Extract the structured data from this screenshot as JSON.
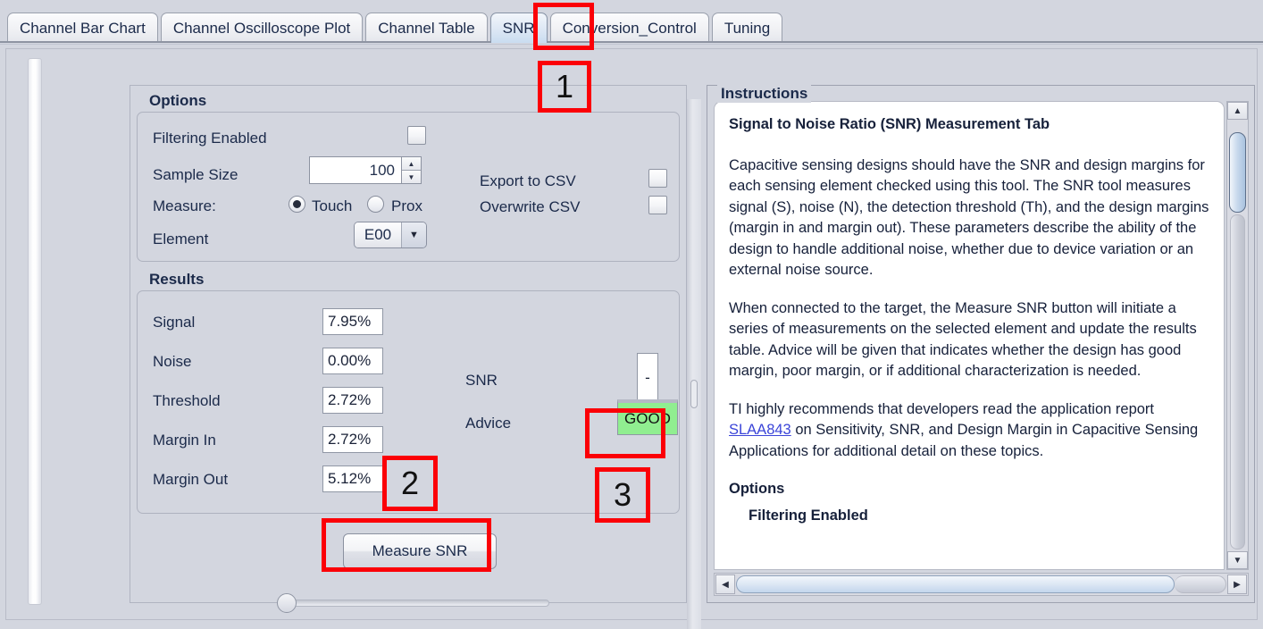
{
  "tabs": [
    {
      "label": "Channel Bar Chart",
      "selected": false
    },
    {
      "label": "Channel Oscilloscope Plot",
      "selected": false
    },
    {
      "label": "Channel Table",
      "selected": false
    },
    {
      "label": "SNR",
      "selected": true
    },
    {
      "label": "Conversion_Control",
      "selected": false
    },
    {
      "label": "Tuning",
      "selected": false
    }
  ],
  "options": {
    "title": "Options",
    "filtering_label": "Filtering Enabled",
    "filtering_checked": false,
    "sample_size_label": "Sample Size",
    "sample_size_value": "100",
    "measure_label": "Measure:",
    "measure_touch_label": "Touch",
    "measure_prox_label": "Prox",
    "measure_selected": "Touch",
    "element_label": "Element",
    "element_value": "E00",
    "export_csv_label": "Export to CSV",
    "export_csv_checked": false,
    "overwrite_csv_label": "Overwrite CSV",
    "overwrite_csv_checked": false,
    "spin_up_glyph": "▲",
    "spin_down_glyph": "▼",
    "combo_arrow_glyph": "▼"
  },
  "results": {
    "title": "Results",
    "rows": [
      {
        "label": "Signal",
        "value": "7.95%"
      },
      {
        "label": "Noise",
        "value": "0.00%"
      },
      {
        "label": "Threshold",
        "value": "2.72%"
      },
      {
        "label": "Margin In",
        "value": "2.72%"
      },
      {
        "label": "Margin Out",
        "value": "5.12%"
      }
    ],
    "snr_label": "SNR",
    "snr_value": "-",
    "advice_label": "Advice",
    "advice_value": "GOOD",
    "advice_color": "#90ee90",
    "measure_button_label": "Measure SNR"
  },
  "instructions": {
    "title": "Instructions",
    "heading": "Signal to Noise Ratio (SNR) Measurement Tab",
    "paragraph1": "Capacitive sensing designs should have the SNR and design margins for each sensing element checked using this tool. The SNR tool measures signal (S), noise (N), the detection threshold (Th), and the design margins (margin in and margin out). These parameters describe the ability of the design to handle additional noise, whether due to device variation or an external noise source.",
    "paragraph2": "When connected to the target, the Measure SNR button will initiate a series of measurements on the selected element and update the results table. Advice will be given that indicates whether the design has good margin, poor margin, or if additional characterization is needed.",
    "paragraph3_prefix": "TI highly recommends that developers read the application report ",
    "paragraph3_link": "SLAA843",
    "paragraph3_suffix": " on Sensitivity, SNR, and Design Margin in Capacitive Sensing Applications for additional detail on these topics.",
    "options_heading": "Options",
    "clipped_line": "Filtering Enabled",
    "scroll_up_glyph": "▲",
    "scroll_down_glyph": "▼",
    "scroll_left_glyph": "◀",
    "scroll_right_glyph": "▶"
  },
  "annotations": {
    "marker1": "1",
    "marker2": "2",
    "marker3": "3",
    "color": "#fb0007"
  }
}
